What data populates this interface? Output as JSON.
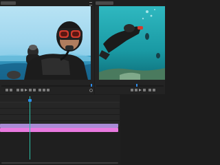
{
  "source_monitor": {
    "tab_label": "",
    "timecode_left": "",
    "timecode_right": ""
  },
  "program_monitor": {
    "tab_label": "",
    "timecode_left": "",
    "timecode_right": ""
  },
  "timeline": {
    "timecode": "",
    "ruler_labels": [
      "",
      "",
      "",
      "",
      "",
      "",
      "",
      ""
    ],
    "clip_label": ""
  },
  "colors": {
    "accent_blue": "#2d8ceb",
    "clip_pink": "#e879df",
    "clip_lavender": "#a98bd6",
    "playhead_teal": "#2bc3a8"
  }
}
